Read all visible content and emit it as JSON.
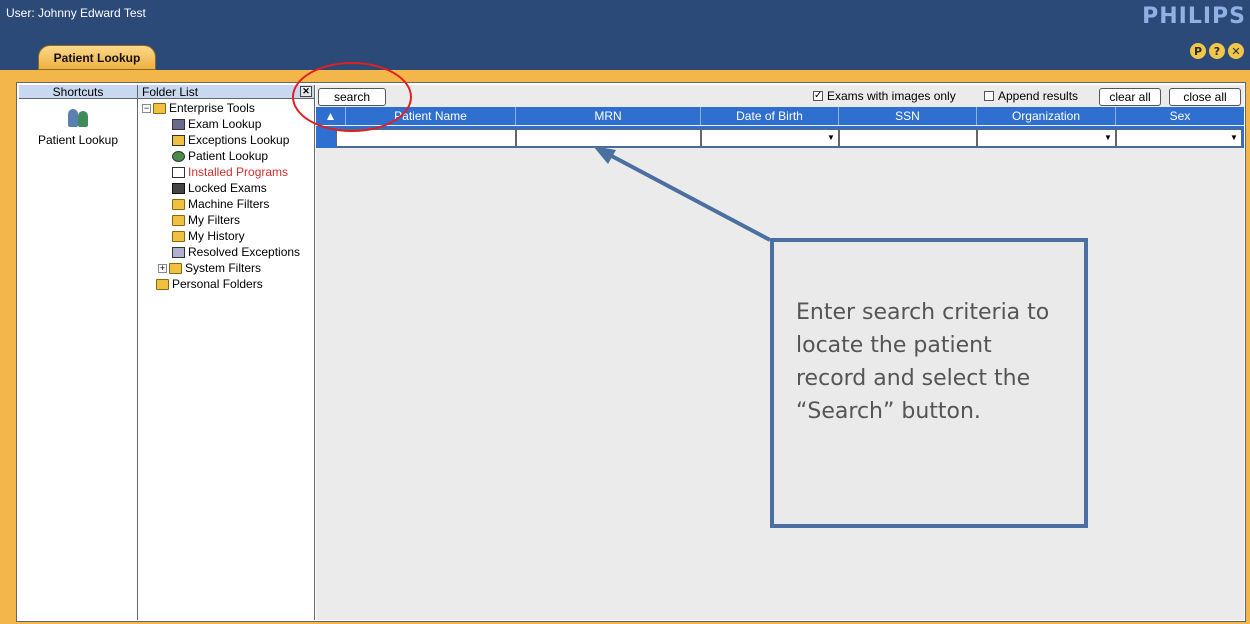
{
  "header": {
    "user_label": "User: Johnny Edward Test",
    "brand": "PHILIPS",
    "icons": [
      "P",
      "?",
      "✕"
    ]
  },
  "tabs": [
    {
      "label": "Patient Lookup"
    }
  ],
  "shortcuts": {
    "title": "Shortcuts",
    "items": [
      {
        "label": "Patient Lookup",
        "icon": "patient-lookup-icon"
      }
    ]
  },
  "folders": {
    "title": "Folder List",
    "tree": [
      {
        "label": "Enterprise Tools",
        "icon": "folder-icon"
      },
      {
        "label": "Exam Lookup",
        "icon": "exam-icon"
      },
      {
        "label": "Exceptions Lookup",
        "icon": "exceptions-icon"
      },
      {
        "label": "Patient Lookup",
        "icon": "patient-icon"
      },
      {
        "label": "Installed Programs",
        "icon": "installed-icon"
      },
      {
        "label": "Locked Exams",
        "icon": "locked-icon"
      },
      {
        "label": "Machine Filters",
        "icon": "folder-icon"
      },
      {
        "label": "My Filters",
        "icon": "folder-icon"
      },
      {
        "label": "My History",
        "icon": "folder-icon"
      },
      {
        "label": "Resolved Exceptions",
        "icon": "resolved-icon"
      },
      {
        "label": "System Filters",
        "icon": "folder-icon"
      },
      {
        "label": "Personal Folders",
        "icon": "folder-icon"
      }
    ]
  },
  "toolbar": {
    "search_label": "search",
    "exams_images_label": "Exams with images only",
    "exams_images_checked": true,
    "append_label": "Append results",
    "append_checked": false,
    "clear_all_label": "clear all",
    "close_all_label": "close all"
  },
  "grid": {
    "sort_glyph": "▲",
    "columns": [
      "Patient Name",
      "MRN",
      "Date of Birth",
      "SSN",
      "Organization",
      "Sex"
    ]
  },
  "callout": {
    "text": "Enter search criteria to locate the patient record and select the “Search” button."
  },
  "colors": {
    "header_bg": "#2b4a78",
    "tab_accent": "#f2b64a",
    "grid_header": "#2f6fd0",
    "annotation_red": "#e02020",
    "callout_border": "#4a6fa0"
  }
}
